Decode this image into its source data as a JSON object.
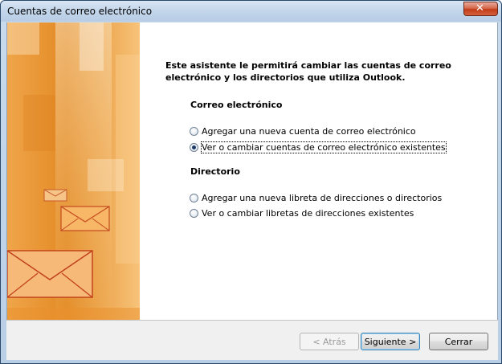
{
  "window": {
    "title": "Cuentas de correo electrónico",
    "close_symbol": "✕"
  },
  "intro_text": "Este asistente le permitirá cambiar las cuentas de correo electrónico y los directorios que utiliza Outlook.",
  "email_section": {
    "heading": "Correo electrónico",
    "options": [
      {
        "label": "Agregar una nueva cuenta de correo electrónico",
        "checked": false
      },
      {
        "label": "Ver o cambiar cuentas de correo electrónico existentes",
        "checked": true
      }
    ]
  },
  "directory_section": {
    "heading": "Directorio",
    "options": [
      {
        "label": "Agregar una nueva libreta de direcciones o directorios",
        "checked": false
      },
      {
        "label": "Ver o cambiar libretas de direcciones existentes",
        "checked": false
      }
    ]
  },
  "buttons": {
    "back": "< Atrás",
    "next": "Siguiente >",
    "close": "Cerrar"
  },
  "colors": {
    "side_art_primary": "#e8962e",
    "side_art_light": "#f8e2b8"
  }
}
